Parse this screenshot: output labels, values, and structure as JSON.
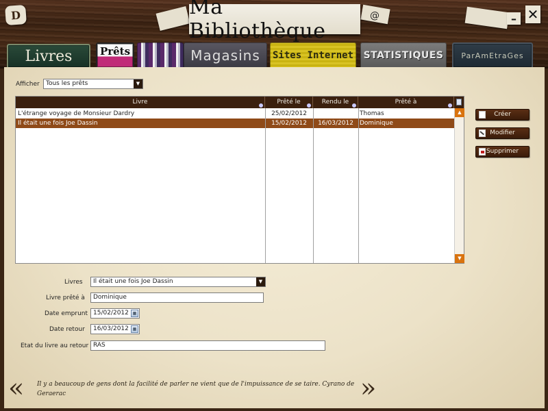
{
  "app": {
    "title": "Ma Bibliothèque",
    "logo": "D",
    "at_icon": "@",
    "minimize_icon": "–",
    "close_icon": "✕"
  },
  "nav": {
    "tabs": [
      {
        "id": "livres",
        "label": "Livres",
        "active": true
      },
      {
        "id": "prets",
        "label": "Prêts"
      },
      {
        "id": "books",
        "label": ""
      },
      {
        "id": "magasins",
        "label": "Magasins"
      },
      {
        "id": "sites",
        "label": "Sites Internet"
      },
      {
        "id": "stats",
        "label": "STATISTIQUES"
      },
      {
        "id": "param",
        "label": "ParAmEtraGes"
      }
    ]
  },
  "filter": {
    "label": "Afficher",
    "value": "Tous les prêts"
  },
  "table": {
    "columns": [
      "Livre",
      "Prêté le",
      "Rendu le",
      "Prêté à"
    ],
    "rows": [
      {
        "livre": "L'étrange voyage de Monsieur Dardry",
        "prete_le": "25/02/2012",
        "rendu_le": "",
        "prete_a": "Thomas",
        "selected": false
      },
      {
        "livre": "Il était une fois Joe Dassin",
        "prete_le": "15/02/2012",
        "rendu_le": "16/03/2012",
        "prete_a": "Dominique",
        "selected": true
      }
    ]
  },
  "actions": {
    "create": "Créer",
    "edit": "Modifier",
    "delete": "Supprimer"
  },
  "form": {
    "livres_label": "Livres",
    "livres_value": "Il était une fois Joe Dassin",
    "prete_a_label": "Livre prêté à",
    "prete_a_value": "Dominique",
    "date_emprunt_label": "Date emprunt",
    "date_emprunt_value": "15/02/2012",
    "date_retour_label": "Date retour",
    "date_retour_value": "16/03/2012",
    "etat_label": "Etat du livre au retour",
    "etat_value": "RAS"
  },
  "footer": {
    "prev_arrow": "«",
    "next_arrow": "»",
    "quote": "Il y a beaucoup de gens dont la facilité de parler ne vient que de l'impuissance de se taire. Cyrano de Geraerac"
  }
}
